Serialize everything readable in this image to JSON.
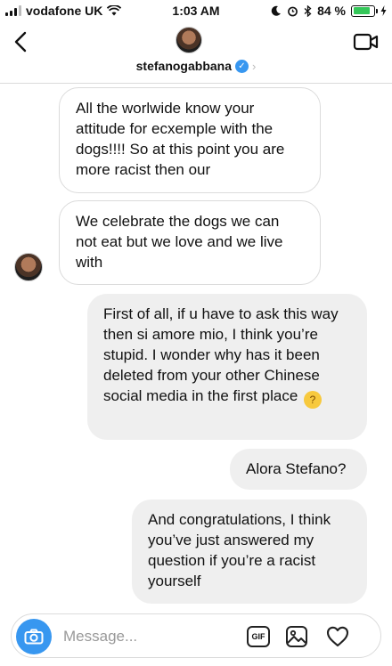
{
  "status_bar": {
    "carrier": "vodafone UK",
    "time": "1:03 AM",
    "battery_percent": "84 %",
    "battery_level": 0.84
  },
  "header": {
    "username": "stefanogabbana",
    "verified": true
  },
  "messages": [
    {
      "side": "received",
      "text": "All the worlwide know your attitude for ecxemple with the dogs!!!! So at this point you are more racist then our"
    },
    {
      "side": "received",
      "text": "We celebrate the dogs we can not eat but we love and we live with"
    },
    {
      "side": "sent",
      "text": "First of all, if u have to ask this way then si amore mio, I think you’re stupid. I wonder why has it been deleted from your other Chinese social media in the first place",
      "emoji": "thinking-face"
    },
    {
      "side": "sent",
      "text": "Alora Stefano?"
    },
    {
      "side": "sent",
      "text": "And congratulations, I think you’ve just answered my question if you’re a racist yourself"
    }
  ],
  "composer": {
    "placeholder": "Message...",
    "gif_label": "GIF"
  },
  "colors": {
    "accent": "#3897f0",
    "sent_bubble": "#efefef",
    "received_border": "#dbdbdb",
    "battery_fill": "#34c759"
  }
}
